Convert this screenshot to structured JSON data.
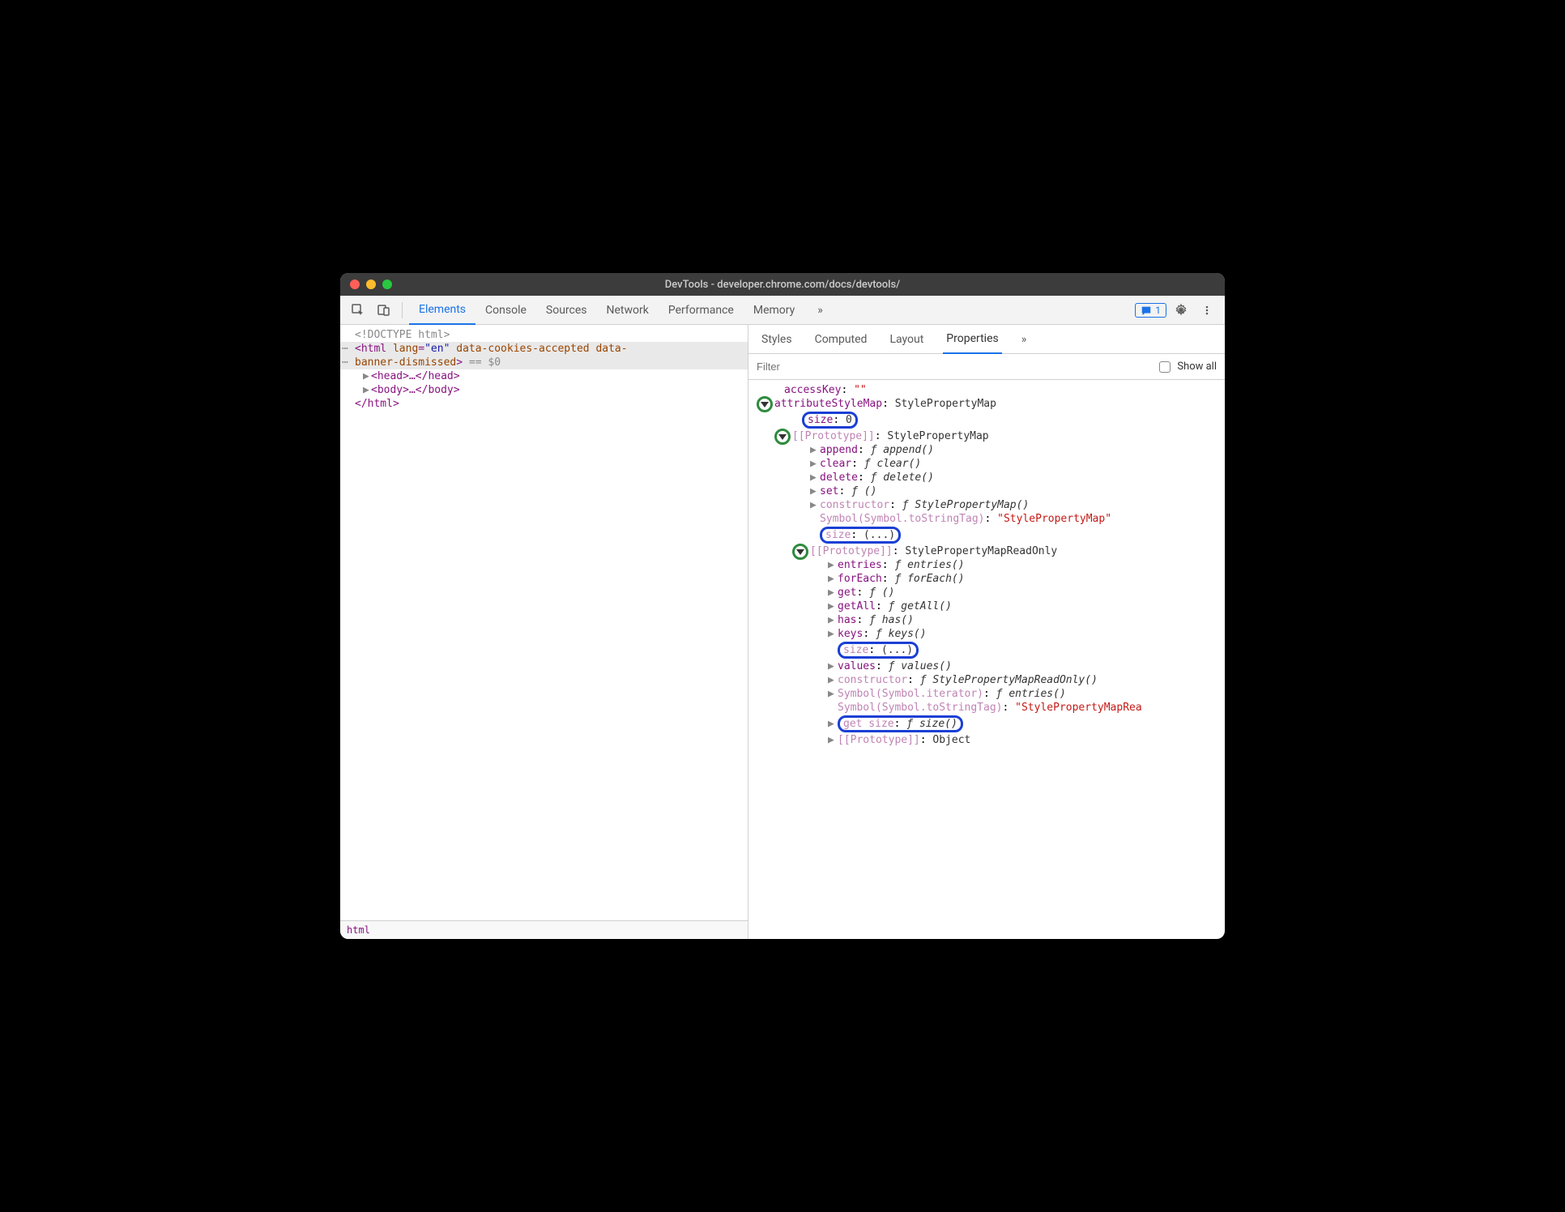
{
  "window": {
    "title": "DevTools - developer.chrome.com/docs/devtools/"
  },
  "toolbar": {
    "tabs": [
      "Elements",
      "Console",
      "Sources",
      "Network",
      "Performance",
      "Memory"
    ],
    "active_tab": "Elements",
    "more": "»",
    "issues_count": "1"
  },
  "dom": {
    "doctype": "<!DOCTYPE html>",
    "html_open_1": "<html",
    "html_attr1_name": "lang",
    "html_attr1_val": "\"en\"",
    "html_attr2": "data-cookies-accepted",
    "html_attr3": "data-",
    "html_open_2": "banner-dismissed",
    "html_close_bracket": ">",
    "console_ref": " == $0",
    "head": "<head>…</head>",
    "body": "<body>…</body>",
    "html_close": "</html>",
    "breadcrumb": "html"
  },
  "sidebar": {
    "tabs": [
      "Styles",
      "Computed",
      "Layout",
      "Properties"
    ],
    "active_tab": "Properties",
    "more": "»",
    "filter_placeholder": "Filter",
    "show_all_label": "Show all"
  },
  "props": [
    {
      "indent": 0,
      "tri": "",
      "name": "accessKey",
      "sep": ": ",
      "val": "\"\"",
      "valcls": "str"
    },
    {
      "indent": 0,
      "green": true,
      "name": "attributeStyleMap",
      "sep": ": ",
      "val": "StylePropertyMap",
      "valcls": "plain"
    },
    {
      "indent": 1,
      "bluebox": true,
      "name": "size",
      "sep": ": ",
      "val": "0",
      "valcls": "plain"
    },
    {
      "indent": 1,
      "green": true,
      "name": "[[Prototype]]",
      "faded": true,
      "sep": ": ",
      "val": "StylePropertyMap",
      "valcls": "plain"
    },
    {
      "indent": 2,
      "tri": "▶",
      "name": "append",
      "sep": ": ",
      "func": "ƒ append()"
    },
    {
      "indent": 2,
      "tri": "▶",
      "name": "clear",
      "sep": ": ",
      "func": "ƒ clear()"
    },
    {
      "indent": 2,
      "tri": "▶",
      "name": "delete",
      "sep": ": ",
      "func": "ƒ delete()"
    },
    {
      "indent": 2,
      "tri": "▶",
      "name": "set",
      "sep": ": ",
      "func": "ƒ ()"
    },
    {
      "indent": 2,
      "tri": "▶",
      "name": "constructor",
      "faded": true,
      "sep": ": ",
      "func": "ƒ StylePropertyMap()"
    },
    {
      "indent": 2,
      "name": "Symbol(Symbol.toStringTag)",
      "faded": true,
      "sep": ": ",
      "val": "\"StylePropertyMap\"",
      "valcls": "str"
    },
    {
      "indent": 2,
      "bluebox": true,
      "name": "size",
      "faded": true,
      "sep": ": ",
      "val": "(...)",
      "valcls": "plain"
    },
    {
      "indent": 2,
      "green": true,
      "name": "[[Prototype]]",
      "faded": true,
      "sep": ": ",
      "val": "StylePropertyMapReadOnly",
      "valcls": "plain"
    },
    {
      "indent": 3,
      "tri": "▶",
      "name": "entries",
      "sep": ": ",
      "func": "ƒ entries()"
    },
    {
      "indent": 3,
      "tri": "▶",
      "name": "forEach",
      "sep": ": ",
      "func": "ƒ forEach()"
    },
    {
      "indent": 3,
      "tri": "▶",
      "name": "get",
      "sep": ": ",
      "func": "ƒ ()"
    },
    {
      "indent": 3,
      "tri": "▶",
      "name": "getAll",
      "sep": ": ",
      "func": "ƒ getAll()"
    },
    {
      "indent": 3,
      "tri": "▶",
      "name": "has",
      "sep": ": ",
      "func": "ƒ has()"
    },
    {
      "indent": 3,
      "tri": "▶",
      "name": "keys",
      "sep": ": ",
      "func": "ƒ keys()"
    },
    {
      "indent": 3,
      "bluebox": true,
      "name": "size",
      "faded": true,
      "sep": ": ",
      "val": "(...)",
      "valcls": "plain"
    },
    {
      "indent": 3,
      "tri": "▶",
      "name": "values",
      "sep": ": ",
      "func": "ƒ values()"
    },
    {
      "indent": 3,
      "tri": "▶",
      "name": "constructor",
      "faded": true,
      "sep": ": ",
      "func": "ƒ StylePropertyMapReadOnly()"
    },
    {
      "indent": 3,
      "tri": "▶",
      "name": "Symbol(Symbol.iterator)",
      "faded": true,
      "sep": ": ",
      "func": "ƒ entries()"
    },
    {
      "indent": 3,
      "name": "Symbol(Symbol.toStringTag)",
      "faded": true,
      "sep": ": ",
      "val": "\"StylePropertyMapRea",
      "valcls": "str",
      "nowrap": true
    },
    {
      "indent": 3,
      "tri": "▶",
      "bluebox": true,
      "name": "get size",
      "faded": true,
      "sep": ": ",
      "func": "ƒ size()"
    },
    {
      "indent": 3,
      "tri": "▶",
      "name": "[[Prototype]]",
      "faded": true,
      "sep": ": ",
      "val": "Object",
      "valcls": "plain"
    }
  ]
}
